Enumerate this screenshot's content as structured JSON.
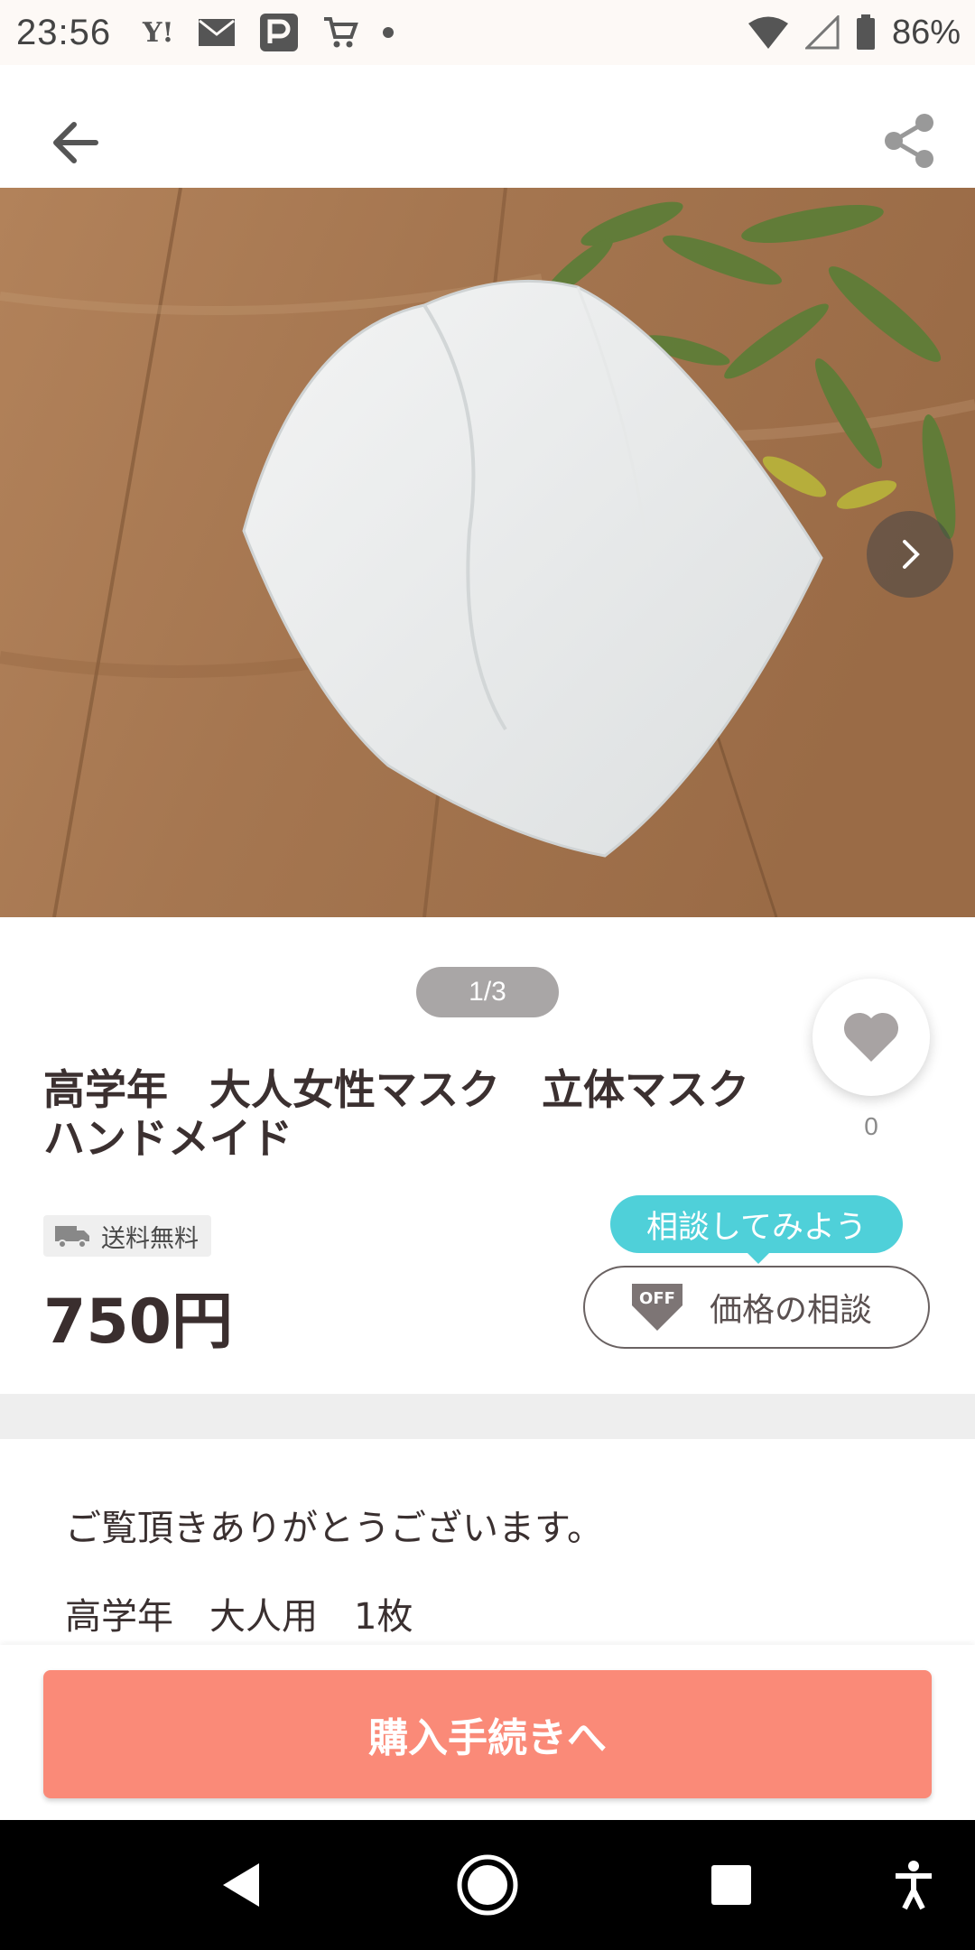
{
  "status_bar": {
    "time": "23:56",
    "notification_icons": [
      "yahoo-icon",
      "mail-icon",
      "paypay-icon",
      "cart-icon",
      "dot-icon"
    ],
    "battery_percent": "86%"
  },
  "product": {
    "image_counter": "1/3",
    "favorite_count": "0",
    "title": "高学年　大人女性マスク　立体マスクハンドメイド",
    "shipping_badge": "送料無料",
    "price": "750円"
  },
  "consult": {
    "tooltip": "相談してみよう",
    "button_label": "価格の相談",
    "badge_text": "OFF"
  },
  "description": {
    "line1": "ご覧頂きありがとうございます。",
    "line2": "高学年　大人用　1枚"
  },
  "actions": {
    "buy_label": "購入手続きへ"
  },
  "colors": {
    "accent_buy": "#fa8a78",
    "tooltip": "#4fd0d9"
  }
}
